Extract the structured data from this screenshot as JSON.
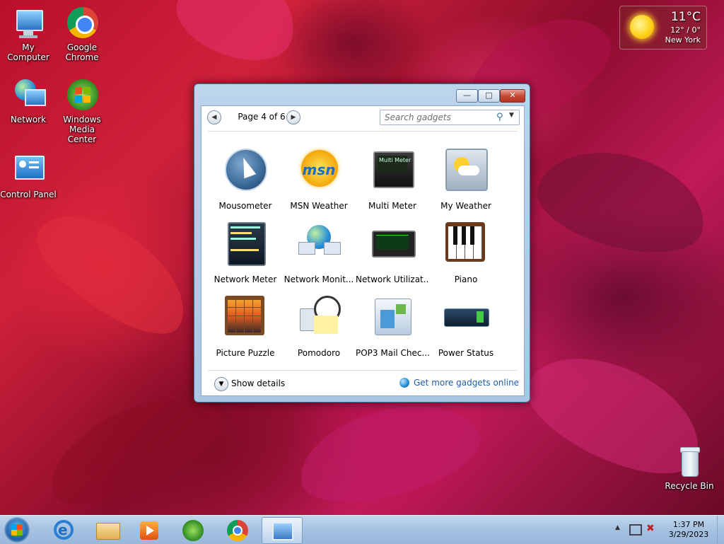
{
  "desktop": {
    "icons": [
      {
        "label": "My Computer",
        "icon": "my-computer-icon"
      },
      {
        "label": "Google Chrome",
        "icon": "chrome-icon"
      },
      {
        "label": "Network",
        "icon": "network-icon"
      },
      {
        "label": "Windows Media Center",
        "icon": "media-center-icon"
      },
      {
        "label": "Control Panel",
        "icon": "control-panel-icon"
      },
      {
        "label": "Recycle Bin",
        "icon": "recycle-bin-icon"
      }
    ]
  },
  "weather_gadget": {
    "temperature": "11°C",
    "range": "12° / 0°",
    "city": "New York",
    "icon": "sun-icon"
  },
  "gallery": {
    "page_label": "Page 4 of 6",
    "search_placeholder": "Search gadgets",
    "show_details": "Show details",
    "get_more": "Get more gadgets online",
    "gadgets": [
      {
        "label": "Mousometer",
        "icon": "mousometer-icon"
      },
      {
        "label": "MSN Weather",
        "icon": "msn-weather-icon"
      },
      {
        "label": "Multi Meter",
        "icon": "multi-meter-icon"
      },
      {
        "label": "My Weather",
        "icon": "my-weather-icon"
      },
      {
        "label": "Network Meter",
        "icon": "network-meter-icon"
      },
      {
        "label": "Network Monit...",
        "icon": "network-monitor-icon"
      },
      {
        "label": "Network Utilizat...",
        "icon": "network-utilization-icon"
      },
      {
        "label": "Piano",
        "icon": "piano-icon"
      },
      {
        "label": "Picture Puzzle",
        "icon": "picture-puzzle-icon"
      },
      {
        "label": "Pomodoro",
        "icon": "pomodoro-icon"
      },
      {
        "label": "POP3 Mail Chec...",
        "icon": "pop3-mail-icon"
      },
      {
        "label": "Power Status",
        "icon": "power-status-icon"
      }
    ]
  },
  "taskbar": {
    "time": "1:37 PM",
    "date": "3/29/2023",
    "pinned": [
      "internet-explorer-icon",
      "windows-explorer-icon",
      "media-player-icon",
      "media-center-icon",
      "chrome-icon",
      "gadget-gallery-icon"
    ]
  }
}
